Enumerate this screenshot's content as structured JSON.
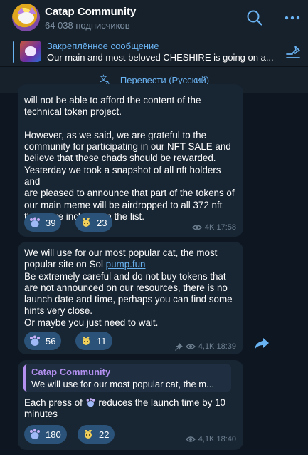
{
  "header": {
    "title": "Catap Community",
    "subtitle": "64 038 подписчиков"
  },
  "pinned": {
    "title": "Закреплённое сообщение",
    "text": "Our main and most beloved CHESHIRE is going on a..."
  },
  "translate": {
    "label": "Перевести (Русский)"
  },
  "messages": [
    {
      "text": "will not be able to afford the content of the\ntechnical token project.\n\n However, as we said, we are grateful to the\ncommunity for participating in our NFT SALE and\nbelieve that these chads should be rewarded.\nYesterday we took a snapshot of all nft holders and\nare pleased to announce that part of the tokens of\nour main meme will be airdropped to all 372 nft\nthat were included in the list.",
      "reactions": [
        {
          "icon": "cat-paw-emoji",
          "count": "39"
        },
        {
          "icon": "sparkle-cat-emoji",
          "count": "23"
        }
      ],
      "views": "4K",
      "time": "17:58"
    },
    {
      "text_before_link": "We will use for our most popular cat, the most\npopular site on Sol ",
      "link": "pump.fun",
      "text_after_link": "\n Be extremely careful and do not buy tokens that\nare not announced on our resources, there is no\nlaunch date and time, perhaps you can find some\nhints very close.\n Or maybe you just need to wait.",
      "reactions": [
        {
          "icon": "cat-paw-emoji",
          "count": "56"
        },
        {
          "icon": "sparkle-cat-emoji",
          "count": "11"
        }
      ],
      "views": "4,1K",
      "time": "18:39"
    },
    {
      "reply_name": "Catap Community",
      "reply_text": "We will use for our most popular cat, the m...",
      "text_before_emoji": "Each press of ",
      "text_after_emoji": " reduces the launch time by 10\nminutes",
      "reactions": [
        {
          "icon": "cat-paw-emoji",
          "count": "180"
        },
        {
          "icon": "sparkle-cat-emoji",
          "count": "22"
        }
      ],
      "views": "4,1K",
      "time": "18:40"
    }
  ],
  "colors": {
    "background": "#0e1621",
    "header": "#17212b",
    "bubble": "#182533",
    "accent": "#6ab3f3",
    "reaction": "#2b5278",
    "reply_accent": "#b38ff0"
  }
}
